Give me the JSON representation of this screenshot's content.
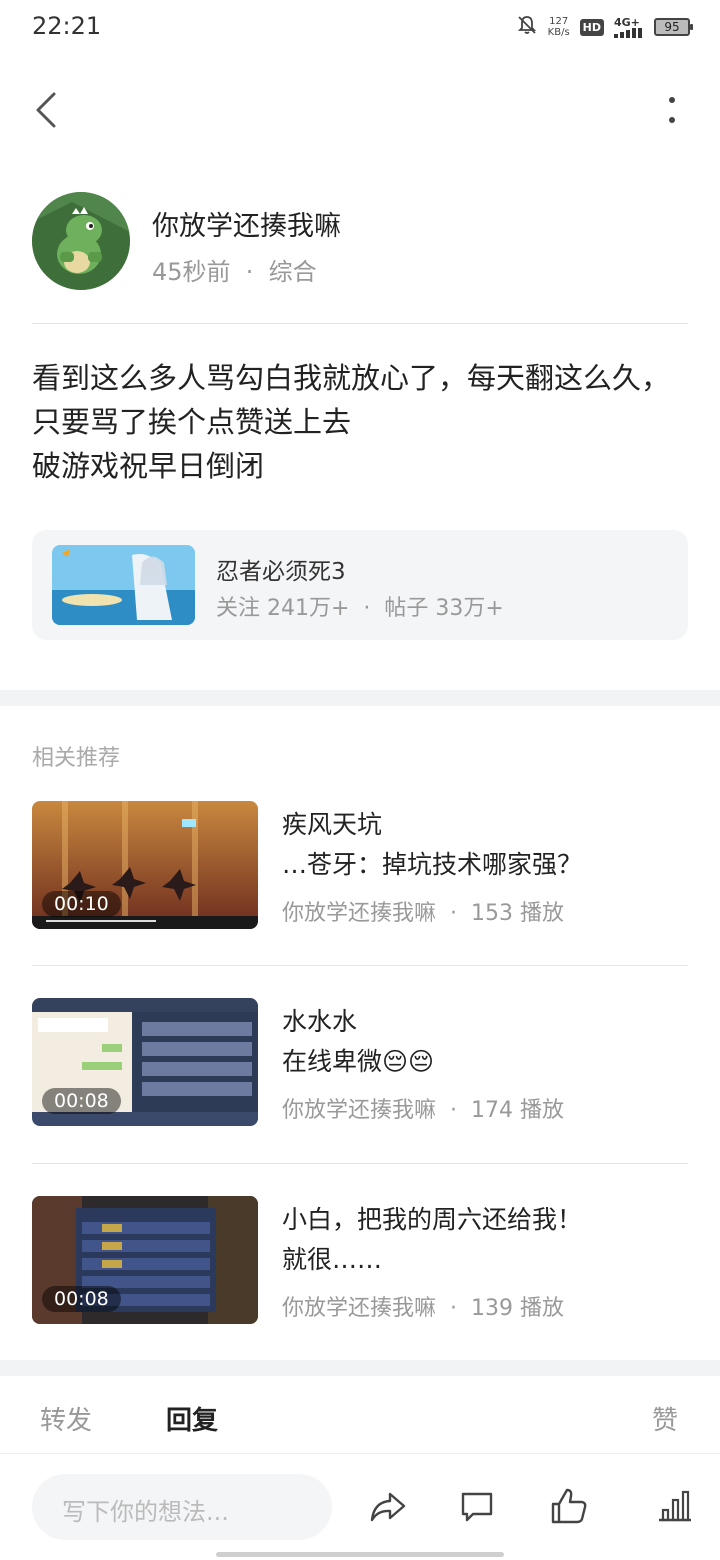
{
  "status_bar": {
    "time": "22:21",
    "net_speed_value": "127",
    "net_speed_unit": "KB/s",
    "hd": "HD",
    "network": "4G+",
    "battery": "95"
  },
  "nav": {
    "back_icon": "chevron-left-icon",
    "more_icon": "more-vertical-icon"
  },
  "author": {
    "name": "你放学还揍我嘛",
    "meta": "45秒前  ·  综合"
  },
  "post": {
    "line1": "看到这么多人骂勾白我就放心了，每天翻这么久，只要骂了挨个点赞送上去",
    "line2": "破游戏祝早日倒闭"
  },
  "forum": {
    "name": "忍者必须死3",
    "stats": "关注 241万+  ·  帖子 33万+"
  },
  "related": {
    "title": "相关推荐",
    "items": [
      {
        "title": "疾风天坑\n…苍牙：掉坑技术哪家强？",
        "meta": "你放学还揍我嘛  ·  153 播放",
        "duration": "00:10"
      },
      {
        "title": "水水水\n在线卑微😔😔",
        "meta": "你放学还揍我嘛  ·  174 播放",
        "duration": "00:08"
      },
      {
        "title": "小白，把我的周六还给我！\n就很……",
        "meta": "你放学还揍我嘛  ·  139 播放",
        "duration": "00:08"
      }
    ]
  },
  "tabs": {
    "forward": "转发",
    "reply": "回复",
    "like": "赞"
  },
  "toolbar": {
    "placeholder": "写下你的想法...",
    "icons": [
      "share-icon",
      "comment-icon",
      "thumbs-up-icon",
      "stats-icon"
    ]
  }
}
